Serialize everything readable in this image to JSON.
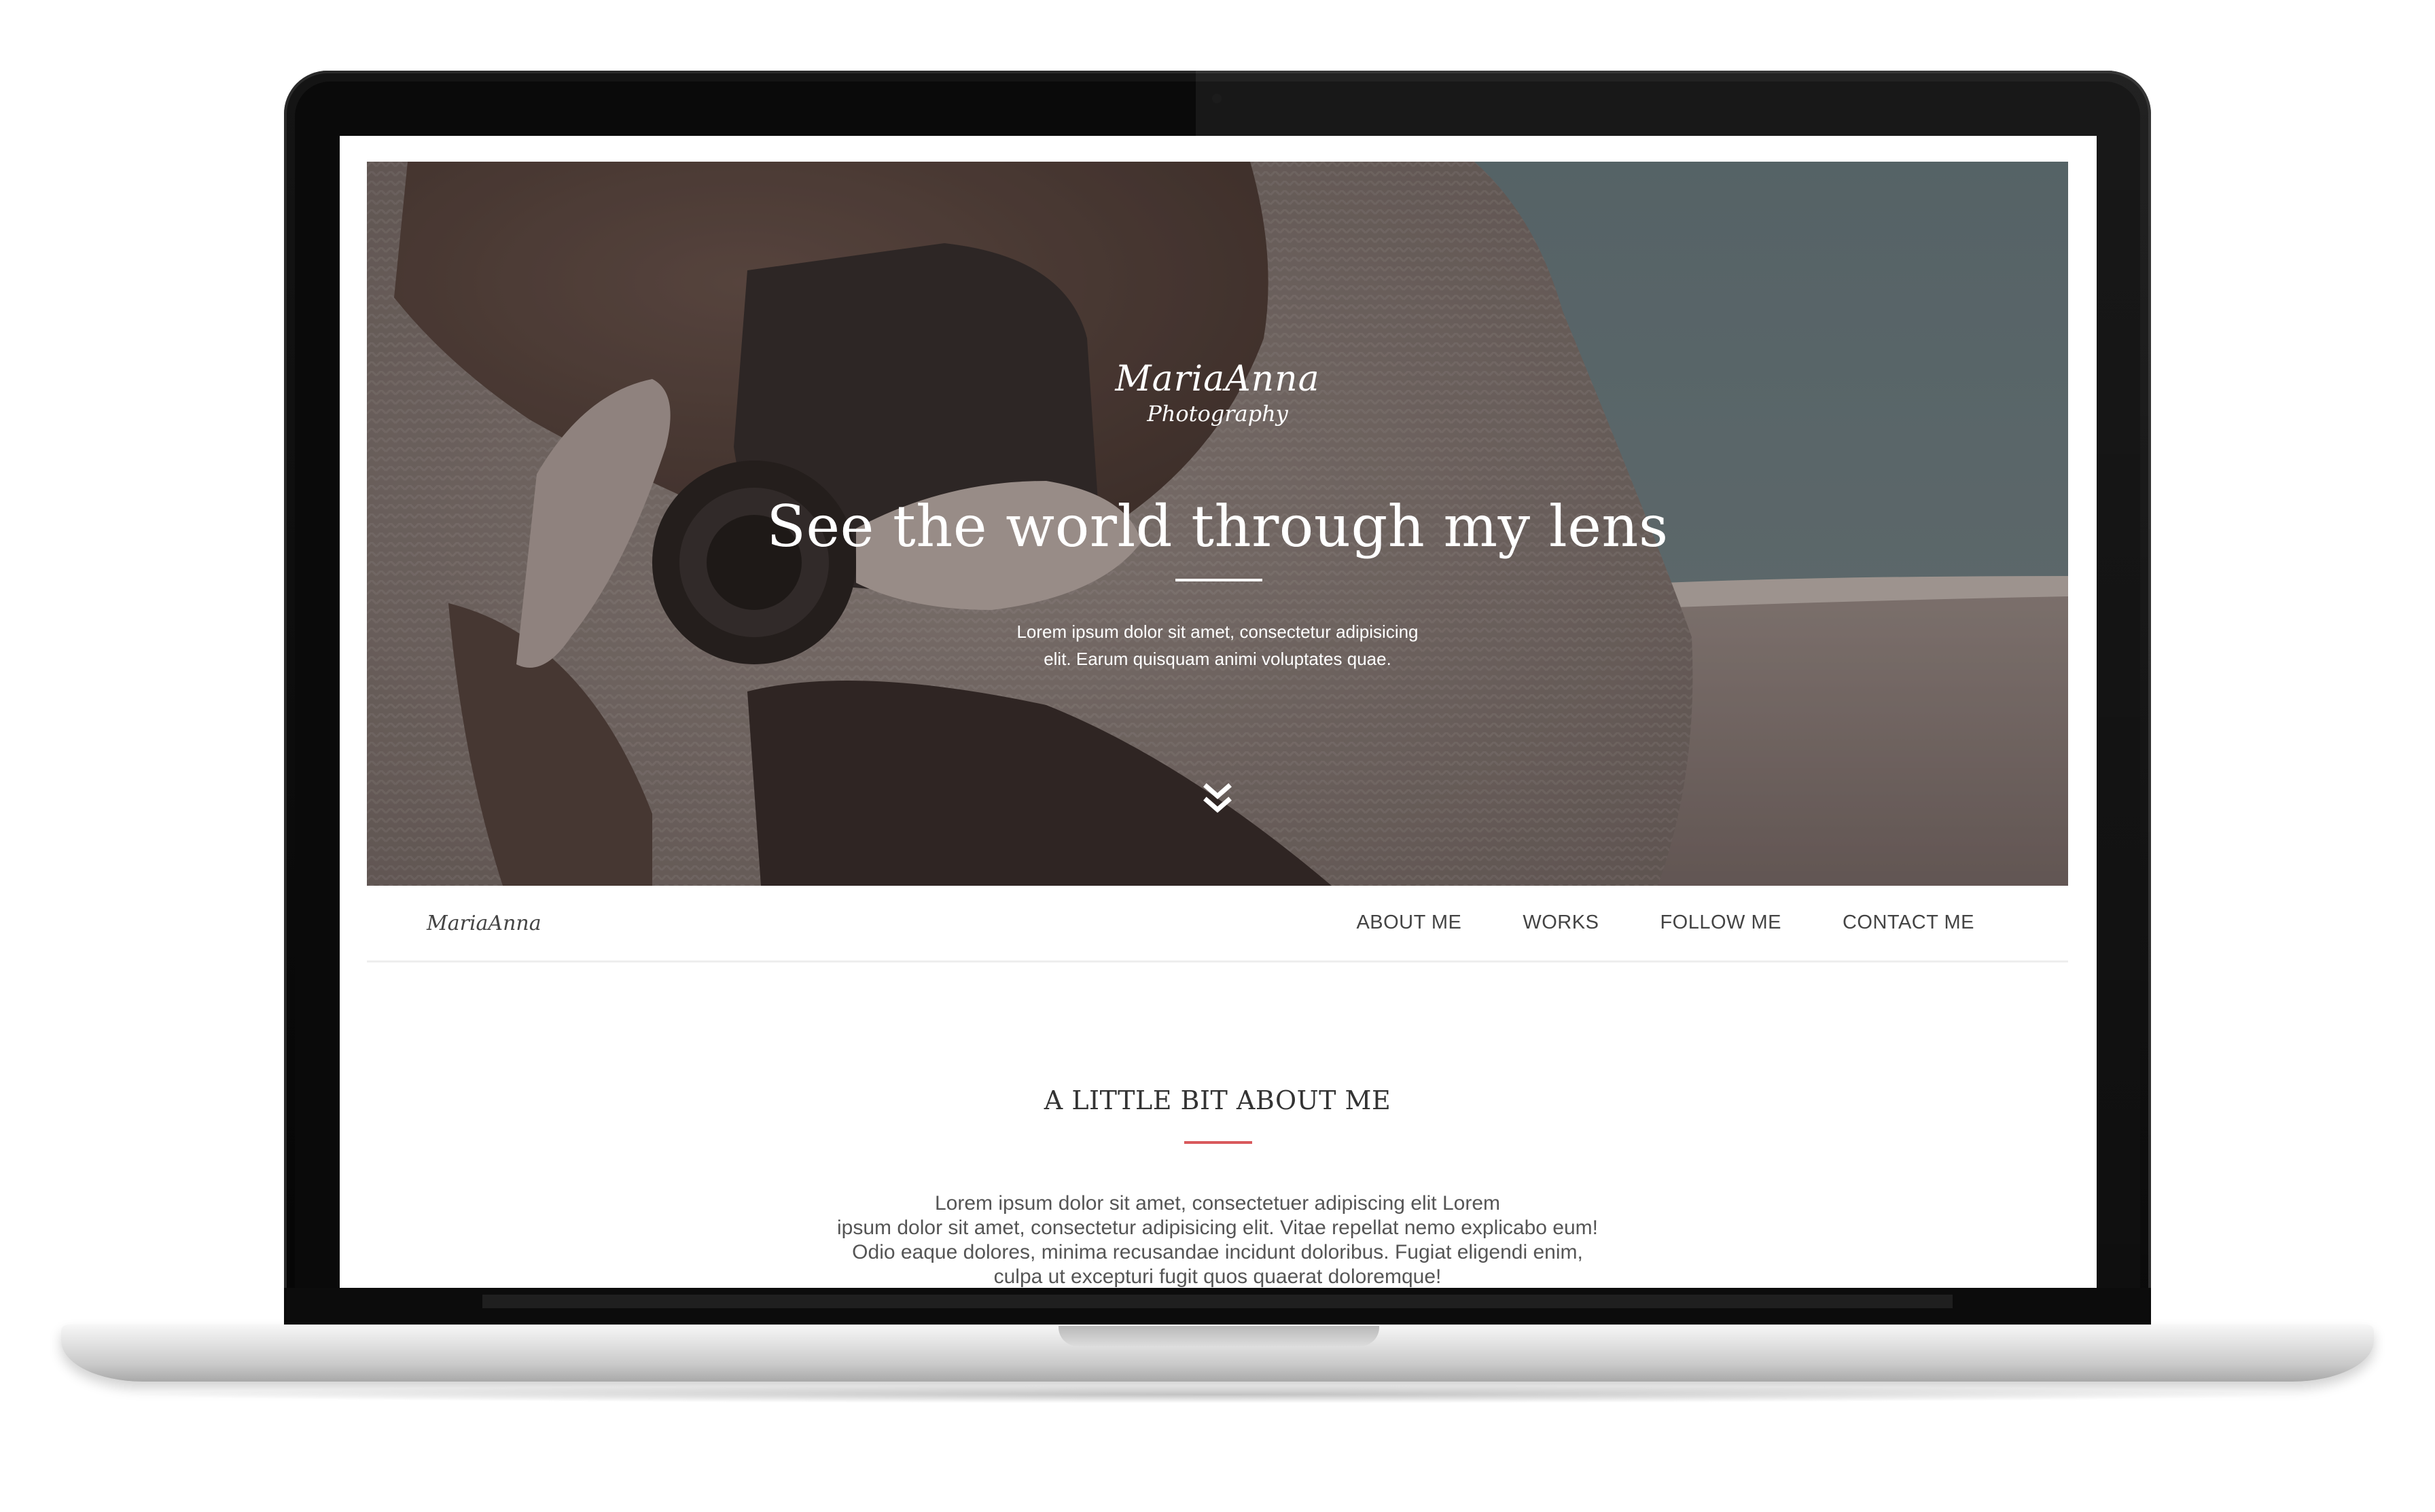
{
  "hero": {
    "logo_main": "MariaAnna",
    "logo_sub": "Photography",
    "title": "See the world through my lens",
    "text_lines": [
      "Lorem ipsum dolor sit amet, consectetur adipisicing",
      "elit. Earum quisquam animi voluptates quae."
    ],
    "scroll_icon": "chevron-double-down-icon"
  },
  "nav": {
    "logo": "MariaAnna",
    "items": [
      "ABOUT ME",
      "WORKS",
      "FOLLOW ME",
      "CONTACT ME"
    ]
  },
  "about": {
    "title": "A LITTLE BIT ABOUT ME",
    "text_lines": [
      "Lorem ipsum dolor sit amet, consectetuer adipiscing elit Lorem",
      "ipsum dolor sit amet, consectetur adipisicing elit. Vitae repellat nemo explicabo eum!",
      "Odio eaque dolores, minima recusandae incidunt doloribus. Fugiat eligendi enim,",
      "culpa ut excepturi fugit quos quaerat doloremque!"
    ]
  },
  "colors": {
    "accent": "#d9595c",
    "text": "#444444",
    "hero_teal": "#5e7379"
  }
}
